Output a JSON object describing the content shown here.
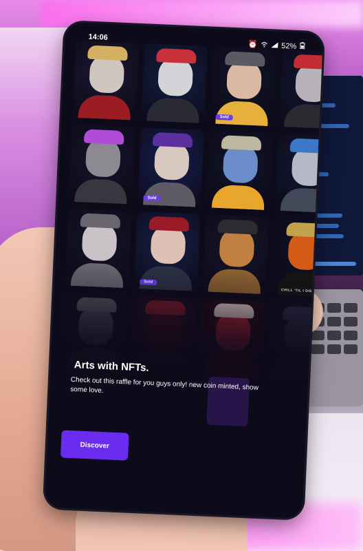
{
  "status_bar": {
    "time": "14:06",
    "battery": "52%"
  },
  "grid": {
    "tiles": [
      {
        "sold": false,
        "palette": {
          "bg": "#1d1830",
          "head": "#cfc6bf",
          "body": "#9b1c22",
          "hat": "#d4b062"
        }
      },
      {
        "sold": false,
        "palette": {
          "bg": "#122040",
          "head": "#d3d3d8",
          "body": "#2a2a35",
          "hat": "#c8313a"
        }
      },
      {
        "sold": true,
        "palette": {
          "bg": "#111428",
          "head": "#d9b9a4",
          "body": "#e6b03a",
          "hat": "#5a5a62"
        }
      },
      {
        "sold": false,
        "palette": {
          "bg": "#101830",
          "head": "#b8b3b8",
          "body": "#2c2830",
          "hat": "#c22c32"
        }
      },
      {
        "sold": false,
        "palette": {
          "bg": "#16142a",
          "head": "#8d8990",
          "body": "#3a3640",
          "hat": "#b24cd8"
        }
      },
      {
        "sold": true,
        "palette": {
          "bg": "#152050",
          "head": "#d7c7bf",
          "body": "#5e5a66",
          "hat": "#5b2f9e"
        }
      },
      {
        "sold": false,
        "palette": {
          "bg": "#111428",
          "head": "#6a8cc8",
          "body": "#e9a62c",
          "hat": "#bdb6a0"
        }
      },
      {
        "sold": false,
        "palette": {
          "bg": "#121830",
          "head": "#b5b9c5",
          "body": "#424a5a",
          "hat": "#3b78c8"
        }
      },
      {
        "sold": false,
        "palette": {
          "bg": "#15132a",
          "head": "#c9c3c7",
          "body": "#6a6670",
          "hat": "#6a6670"
        }
      },
      {
        "sold": true,
        "palette": {
          "bg": "#152046",
          "head": "#dcc1b4",
          "body": "#2b3042",
          "hat": "#9b1a28"
        }
      },
      {
        "sold": false,
        "palette": {
          "bg": "#141628",
          "head": "#c27f42",
          "body": "#8a6030",
          "hat": "#2c2c30"
        }
      },
      {
        "sold": false,
        "palette": {
          "bg": "#101020",
          "head": "#d45a18",
          "body": "#151515",
          "hat": "#c2a24c"
        },
        "label": "CHILL 'TIL I DIE"
      },
      {
        "sold": false,
        "palette": {
          "bg": "#14122a",
          "head": "#4a4a55",
          "body": "#2a2835",
          "hat": "#555560"
        }
      },
      {
        "sold": false,
        "palette": {
          "bg": "#2a0f20",
          "head": "#3a0e1a",
          "body": "#1a1020",
          "hat": "#7a1a2a"
        }
      },
      {
        "sold": false,
        "palette": {
          "bg": "#3a0c14",
          "head": "#b12030",
          "body": "#5a0e18",
          "hat": "#e0c8c0"
        }
      },
      {
        "sold": false,
        "palette": {
          "bg": "#14122a",
          "head": "#2a2840",
          "body": "#1a1830",
          "hat": "#2a2840"
        }
      }
    ],
    "sold_label": "Sold"
  },
  "hero": {
    "title": "Arts with NFTs.",
    "description": "Check out this raffle for you guys only! new coin minted, show some love."
  },
  "cta": {
    "label": "Discover"
  },
  "colors": {
    "accent": "#6a2df0",
    "phone_bg": "#0d0a1a"
  }
}
